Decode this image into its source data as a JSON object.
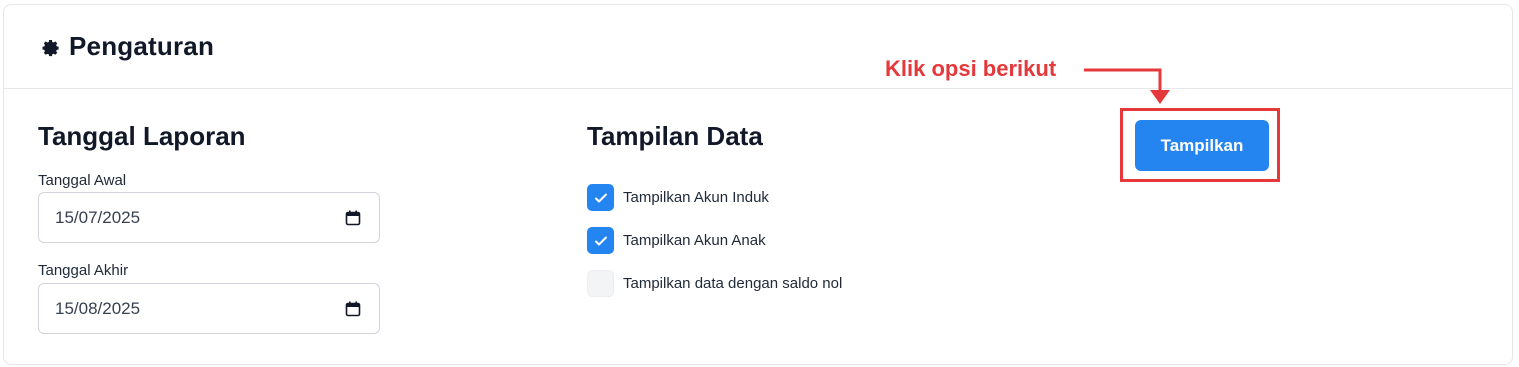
{
  "header": {
    "icon": "gear-icon",
    "title": "Pengaturan"
  },
  "report_date": {
    "section_title": "Tanggal Laporan",
    "start": {
      "label": "Tanggal Awal",
      "value": "15/07/2025",
      "icon": "calendar-icon"
    },
    "end": {
      "label": "Tanggal Akhir",
      "value": "15/08/2025",
      "icon": "calendar-icon"
    }
  },
  "data_display": {
    "section_title": "Tampilan Data",
    "options": [
      {
        "label": "Tampilkan Akun Induk",
        "checked": true
      },
      {
        "label": "Tampilkan Akun Anak",
        "checked": true
      },
      {
        "label": "Tampilkan data dengan saldo nol",
        "checked": false
      }
    ]
  },
  "actions": {
    "show_button_label": "Tampilkan"
  },
  "annotation": {
    "text": "Klik opsi berikut",
    "color": "#e5383b"
  },
  "colors": {
    "primary": "#2485f0",
    "annotation_red": "#e5383b",
    "text_dark": "#111827"
  }
}
